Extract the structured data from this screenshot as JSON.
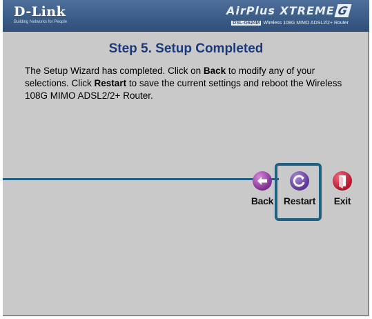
{
  "header": {
    "logo": "D-Link",
    "tagline": "Building Networks for People",
    "brand": "AirPlus XTREME",
    "brand_g": "G",
    "model": "DSL-G624M",
    "product": "Wireless 108G MIMO ADSL2/2+ Router"
  },
  "main": {
    "title": "Step 5. Setup Completed",
    "line1_pre": "The Setup Wizard has completed. Click on ",
    "line1_bold": "Back",
    "line1_post": " to modify any of your selections. Click ",
    "line2_bold": "Restart",
    "line2_post": " to save the current settings and reboot the Wireless 108G MIMO ADSL2/2+ Router."
  },
  "buttons": {
    "back": {
      "label": "Back",
      "icon": "back-arrow-icon",
      "color": "#8e3b9c"
    },
    "restart": {
      "label": "Restart",
      "icon": "restart-icon",
      "color": "#6a3fa3"
    },
    "exit": {
      "label": "Exit",
      "icon": "exit-door-icon",
      "color": "#c8102e"
    }
  },
  "colors": {
    "title": "#1c3a7a",
    "highlight": "#1f5f82",
    "panel": "#c9c9c9"
  }
}
